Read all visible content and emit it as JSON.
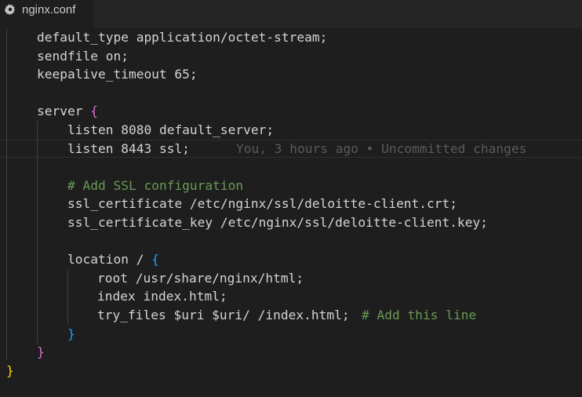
{
  "tab": {
    "filename": "nginx.conf",
    "icon": "gear-icon"
  },
  "code": {
    "lines": {
      "l01": "default_type application/octet-stream;",
      "l02": "sendfile on;",
      "l03": "keepalive_timeout 65;",
      "l05": "server ",
      "l05_brace": "{",
      "l06": "listen 8080 default_server;",
      "l07": "listen 8443 ssl;",
      "l07_blame": "You, 3 hours ago • Uncommitted changes",
      "l09": "# Add SSL configuration",
      "l10": "ssl_certificate /etc/nginx/ssl/deloitte-client.crt;",
      "l11": "ssl_certificate_key /etc/nginx/ssl/deloitte-client.key;",
      "l13": "location / ",
      "l13_brace": "{",
      "l14": "root /usr/share/nginx/html;",
      "l15": "index index.html;",
      "l16": "try_files $uri $uri/ /index.html;",
      "l16_comment": "# Add this line",
      "l17_brace": "}",
      "l18_brace": "}",
      "l19_brace": "}"
    }
  },
  "colors": {
    "background": "#1e1e1e",
    "text": "#d4d4d4",
    "comment": "#6a9955",
    "blame": "#5a5a5a",
    "brace_level1": "#ffd700",
    "brace_level2": "#da70d6",
    "brace_level3": "#179fff"
  }
}
